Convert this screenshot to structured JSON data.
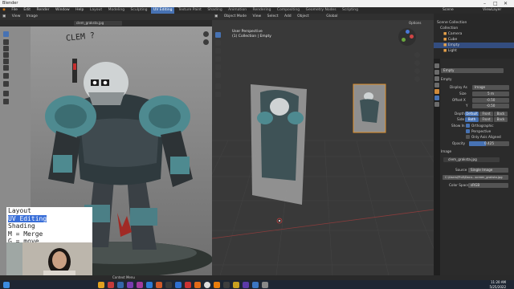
{
  "app": {
    "title": "Blender"
  },
  "top_menu": {
    "items": [
      "File",
      "Edit",
      "Render",
      "Window",
      "Help"
    ],
    "workspaces": [
      "Layout",
      "Modeling",
      "Sculpting",
      "UV Editing",
      "Texture Paint",
      "Shading",
      "Animation",
      "Rendering",
      "Compositing",
      "Geometry Nodes",
      "Scripting"
    ],
    "active_workspace": "UV Editing",
    "scene": "Scene",
    "view_layer": "ViewLayer"
  },
  "image_editor": {
    "header_items": [
      "View",
      "Image"
    ],
    "image_name": "clem_graksta.jpg",
    "handwritten_label": "CLEM ?"
  },
  "viewport": {
    "header_items": [
      "Object Mode",
      "View",
      "Select",
      "Add",
      "Object"
    ],
    "transform": "Global",
    "label_line1": "User Perspective",
    "label_line2": "(1) Collection | Empty",
    "options": "Options"
  },
  "outliner": {
    "rows": [
      {
        "label": "Scene Collection"
      },
      {
        "label": "Collection"
      },
      {
        "label": "Camera"
      },
      {
        "label": "Cube"
      },
      {
        "label": "Empty"
      },
      {
        "label": "Light"
      }
    ]
  },
  "properties": {
    "object_name": "Empty",
    "image_name": "clem_graksta.jpg",
    "section_empty": "Empty",
    "display_as_label": "Display As",
    "display_as_value": "Image",
    "size_label": "Size",
    "size_value": "5 m",
    "offset_label": "Offset X",
    "offset_x": "-0.50",
    "offset_y_label": "Y",
    "offset_y": "-0.50",
    "depth_label": "Depth",
    "depth_options": [
      "Default",
      "Front",
      "Back"
    ],
    "side_label": "Side",
    "side_options": [
      "Both",
      "Front",
      "Back"
    ],
    "show_in_label": "Show In",
    "show_options": [
      "Orthographic",
      "Perspective",
      "Only Axis Aligned"
    ],
    "opacity_label": "Opacity",
    "opacity_value": "0.425",
    "opacity_fraction": 0.425,
    "section_image": "Image",
    "source_label": "Source",
    "source_value": "Single Image",
    "filepath": "C:\\Users\\Phill\\Docu...screen_graksta.jpg",
    "color_space_label": "Color Space",
    "color_space_value": "sRGB"
  },
  "key_overlay": {
    "lines": [
      "Layout",
      "UV Editing",
      "Shading",
      "M = Merge",
      "G = move"
    ],
    "highlight_index": 1
  },
  "statusbar": {
    "left": "Context Menu"
  },
  "taskbar": {
    "time": "11:20 AM",
    "date": "5/25/2022"
  },
  "colors": {
    "accent": "#4772b3",
    "selection": "#334d80",
    "viewport_bg": "#393939",
    "canvas_bg": "#878787"
  }
}
